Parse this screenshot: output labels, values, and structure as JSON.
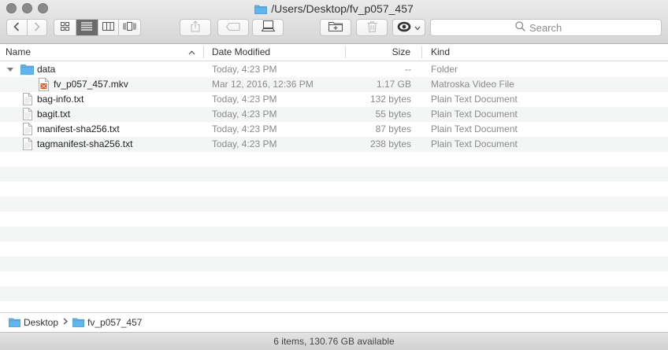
{
  "window": {
    "title": "/Users/Desktop/fv_p057_457",
    "folder_color": "#5fb6ec"
  },
  "toolbar": {
    "back_icon": "chevron-left",
    "forward_icon": "chevron-right",
    "view_modes": [
      "icon",
      "list",
      "column",
      "cover-flow"
    ],
    "active_view": "list",
    "search_placeholder": "Search"
  },
  "columns": {
    "name": "Name",
    "date": "Date Modified",
    "size": "Size",
    "kind": "Kind"
  },
  "files": [
    {
      "name": "data",
      "date": "Today, 4:23 PM",
      "size": "--",
      "kind": "Folder",
      "type": "folder",
      "expanded": true,
      "level": 0
    },
    {
      "name": "fv_p057_457.mkv",
      "date": "Mar 12, 2016, 12:36 PM",
      "size": "1.17 GB",
      "kind": "Matroska Video File",
      "type": "video",
      "level": 1
    },
    {
      "name": "bag-info.txt",
      "date": "Today, 4:23 PM",
      "size": "132 bytes",
      "kind": "Plain Text Document",
      "type": "text",
      "level": 0
    },
    {
      "name": "bagit.txt",
      "date": "Today, 4:23 PM",
      "size": "55 bytes",
      "kind": "Plain Text Document",
      "type": "text",
      "level": 0
    },
    {
      "name": "manifest-sha256.txt",
      "date": "Today, 4:23 PM",
      "size": "87 bytes",
      "kind": "Plain Text Document",
      "type": "text",
      "level": 0
    },
    {
      "name": "tagmanifest-sha256.txt",
      "date": "Today, 4:23 PM",
      "size": "238 bytes",
      "kind": "Plain Text Document",
      "type": "text",
      "level": 0
    }
  ],
  "pathbar": {
    "items": [
      "Desktop",
      "fv_p057_457"
    ]
  },
  "status": {
    "text": "6 items, 130.76 GB available"
  }
}
